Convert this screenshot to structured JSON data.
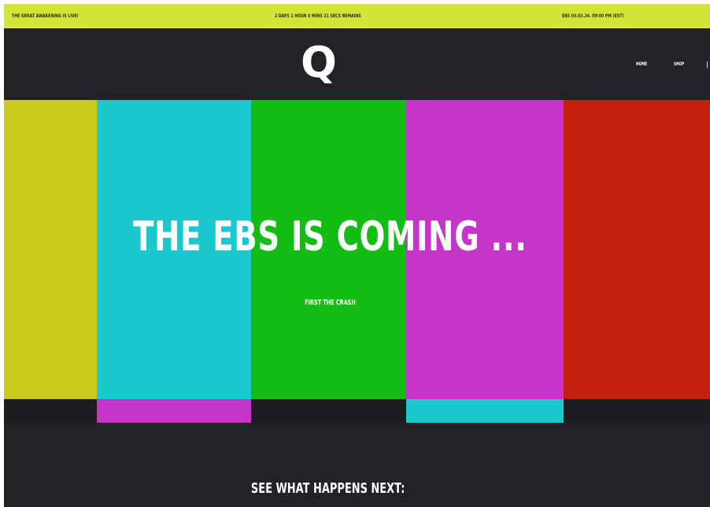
{
  "announcement_bar": {
    "left_text": "THE GREAT AWAKENING IS LIVE!",
    "countdown_text": "2 DAYS 1 HOUR 0 MINS 21 SECS REMAINS",
    "right_text": "EBS 03.03.24. 09:00 PM (EST)",
    "background_color": "#d4e53a"
  },
  "header": {
    "logo_text": "Q",
    "nav": {
      "home_label": "HOME",
      "shop_label": "SHOP"
    }
  },
  "hero": {
    "title": "THE EBS IS COMING ...",
    "subtitle": "FIRST THE CRASH",
    "test_bar_colors": [
      "#cbca1e",
      "#1cc7cd",
      "#14bd14",
      "#c734c9",
      "#c51d0b"
    ],
    "bottom_strip_colors": [
      "#1c1d20",
      "#c734c9",
      "#1c1d20",
      "#1cc7cd",
      "#1c1d20"
    ]
  },
  "section": {
    "title": "SEE WHAT HAPPENS NEXT:"
  }
}
